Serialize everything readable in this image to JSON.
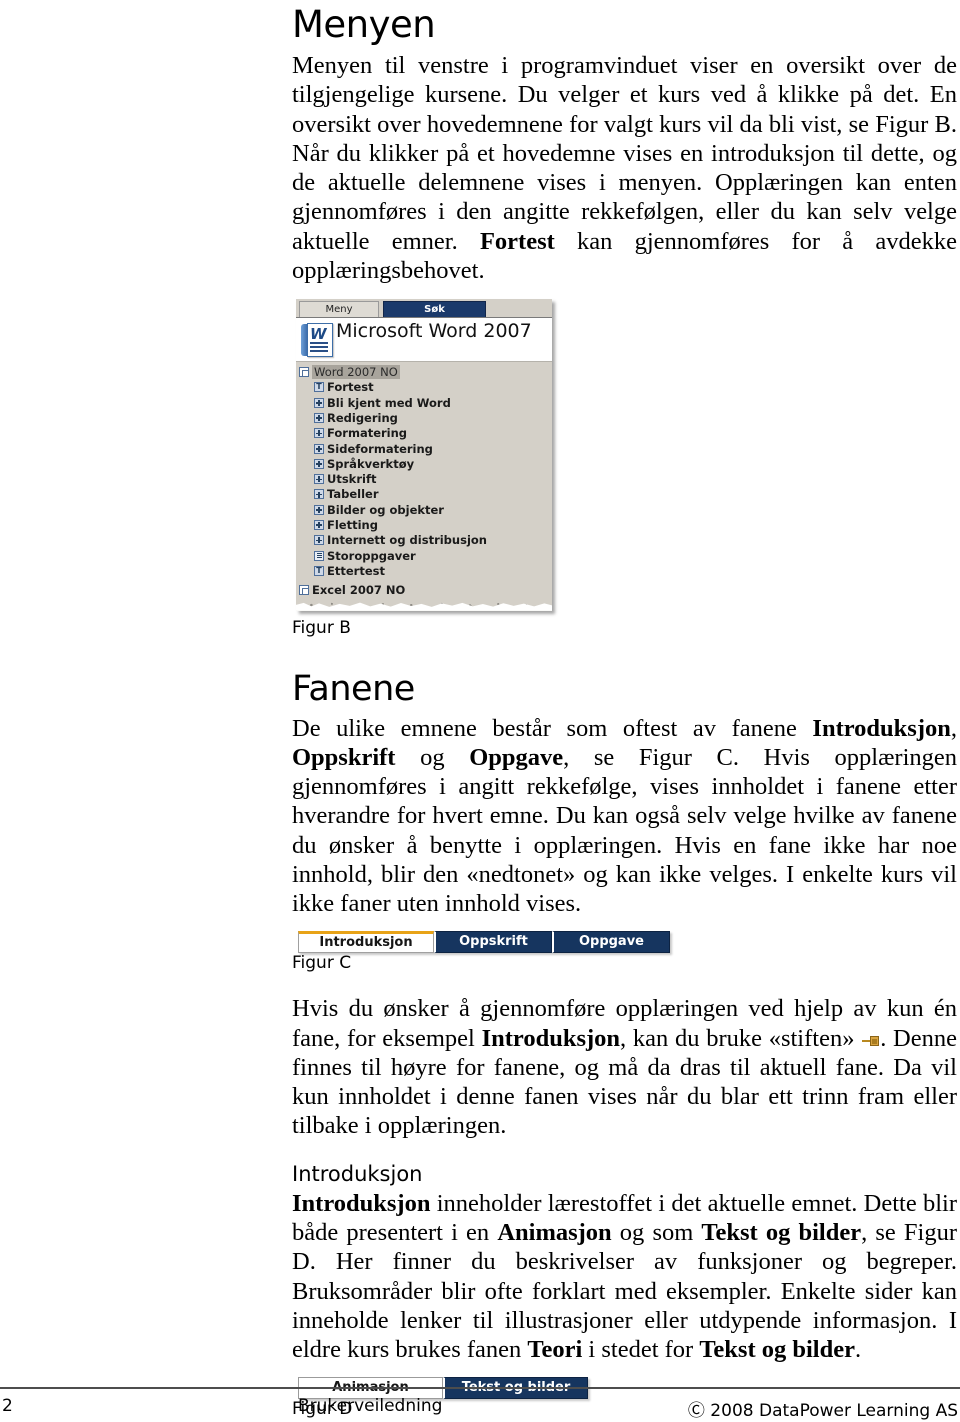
{
  "page": {
    "number": "2"
  },
  "sections": {
    "menyen": {
      "heading": "Menyen",
      "paragraph_html": "Menyen til venstre i programvinduet viser en oversikt over de tilgjengelige kursene. Du velger et kurs ved å klikke på det. En oversikt over hovedemnene for valgt kurs vil da bli vist, se Figur B. Når du klikker på et hovedemne vises en introduksjon til dette, og de aktuelle delemnene vises i menyen. Opplæringen kan enten gjennomføres i den angitte rekkefølgen, eller du kan selv velge aktuelle emner. <b>Fortest</b> kan gjennomføres for å avdekke opplæringsbehovet."
    },
    "fanene": {
      "heading": "Fanene",
      "paragraph1_html": "De ulike emnene består som oftest av fanene <b>Introduksjon</b>, <b>Oppskrift</b> og <b>Oppgave</b>, se Figur C. Hvis opplæringen gjennomføres i angitt rekkefølge, vises innholdet i fanene etter hverandre for hvert emne. Du kan også selv velge hvilke av fanene du ønsker å benytte i opplæringen. Hvis en fane ikke har noe innhold, blir den «nedtonet» og kan ikke velges. I enkelte kurs vil ikke faner uten innhold vises.",
      "paragraph2_html_before": "Hvis du ønsker å gjennomføre opplæringen ved hjelp av kun én fane, for eksempel <b>Introduksjon</b>, kan du bruke «stiften» ",
      "paragraph2_html_after": ". Denne finnes til høyre for fanene, og må da dras til aktuell fane. Da vil kun innholdet i denne fanen vises når du blar ett trinn fram eller tilbake i opplæringen."
    },
    "introduksjon": {
      "heading": "Introduksjon",
      "paragraph_html": "<b>Introduksjon</b> inneholder lærestoffet i det aktuelle emnet. Dette blir både presentert i en <b>Animasjon</b> og som <b>Tekst og bilder</b>, se Figur D. Her finner du beskrivelser av funksjoner og begreper. Bruksområder blir ofte forklart med eksempler. Enkelte sider kan inneholde lenker til illustrasjoner eller utdypende informasjon. I eldre kurs brukes fanen <b>Teori</b> i stedet for <b>Tekst og bilder</b>."
    }
  },
  "figures": {
    "figur_b": {
      "caption": "Figur B",
      "tabs": [
        {
          "label": "Meny",
          "state": "active"
        },
        {
          "label": "Søk",
          "state": "inactive"
        }
      ],
      "header_title": "Microsoft Word 2007",
      "header_icon": "word-document-icon",
      "tree": [
        {
          "label": "Word 2007 NO",
          "icon": "box-icon",
          "level": "root",
          "selected": true
        },
        {
          "label": "Fortest",
          "icon": "t-letter-icon",
          "level": "child",
          "selected": false
        },
        {
          "label": "Bli kjent med Word",
          "icon": "plus-icon",
          "level": "child",
          "selected": false
        },
        {
          "label": "Redigering",
          "icon": "plus-icon",
          "level": "child",
          "selected": false
        },
        {
          "label": "Formatering",
          "icon": "plus-icon",
          "level": "child",
          "selected": false
        },
        {
          "label": "Sideformatering",
          "icon": "plus-icon",
          "level": "child",
          "selected": false
        },
        {
          "label": "Språkverktøy",
          "icon": "plus-icon",
          "level": "child",
          "selected": false
        },
        {
          "label": "Utskrift",
          "icon": "plus-icon",
          "level": "child",
          "selected": false
        },
        {
          "label": "Tabeller",
          "icon": "plus-icon",
          "level": "child",
          "selected": false
        },
        {
          "label": "Bilder og objekter",
          "icon": "plus-icon",
          "level": "child",
          "selected": false
        },
        {
          "label": "Fletting",
          "icon": "plus-icon",
          "level": "child",
          "selected": false
        },
        {
          "label": "Internett og distribusjon",
          "icon": "plus-icon",
          "level": "child",
          "selected": false
        },
        {
          "label": "Storoppgaver",
          "icon": "lines-icon",
          "level": "child",
          "selected": false
        },
        {
          "label": "Ettertest",
          "icon": "t-letter-icon",
          "level": "child",
          "selected": false
        },
        {
          "label": "Excel 2007 NO",
          "icon": "box-icon",
          "level": "root",
          "selected": false
        }
      ]
    },
    "figur_c": {
      "caption": "Figur C",
      "tabs": [
        {
          "label": "Introduksjon",
          "state": "active"
        },
        {
          "label": "Oppskrift",
          "state": "inactive"
        },
        {
          "label": "Oppgave",
          "state": "inactive"
        }
      ]
    },
    "figur_d": {
      "caption": "Figur D",
      "tabs": [
        {
          "label": "Animasjon",
          "state": "active"
        },
        {
          "label": "Tekst og bilder",
          "state": "inactive"
        }
      ]
    }
  },
  "footer": {
    "page_number": "2",
    "center": "Brukerveiledning",
    "copyright": "Ⓒ 2008 DataPower Learning AS"
  },
  "colors": {
    "tab_dark_blue": "#16355f",
    "tab_active_orange": "#e8a317",
    "menu_chrome_gray": "#d4d0c8",
    "pin_orange": "#d9a441"
  }
}
